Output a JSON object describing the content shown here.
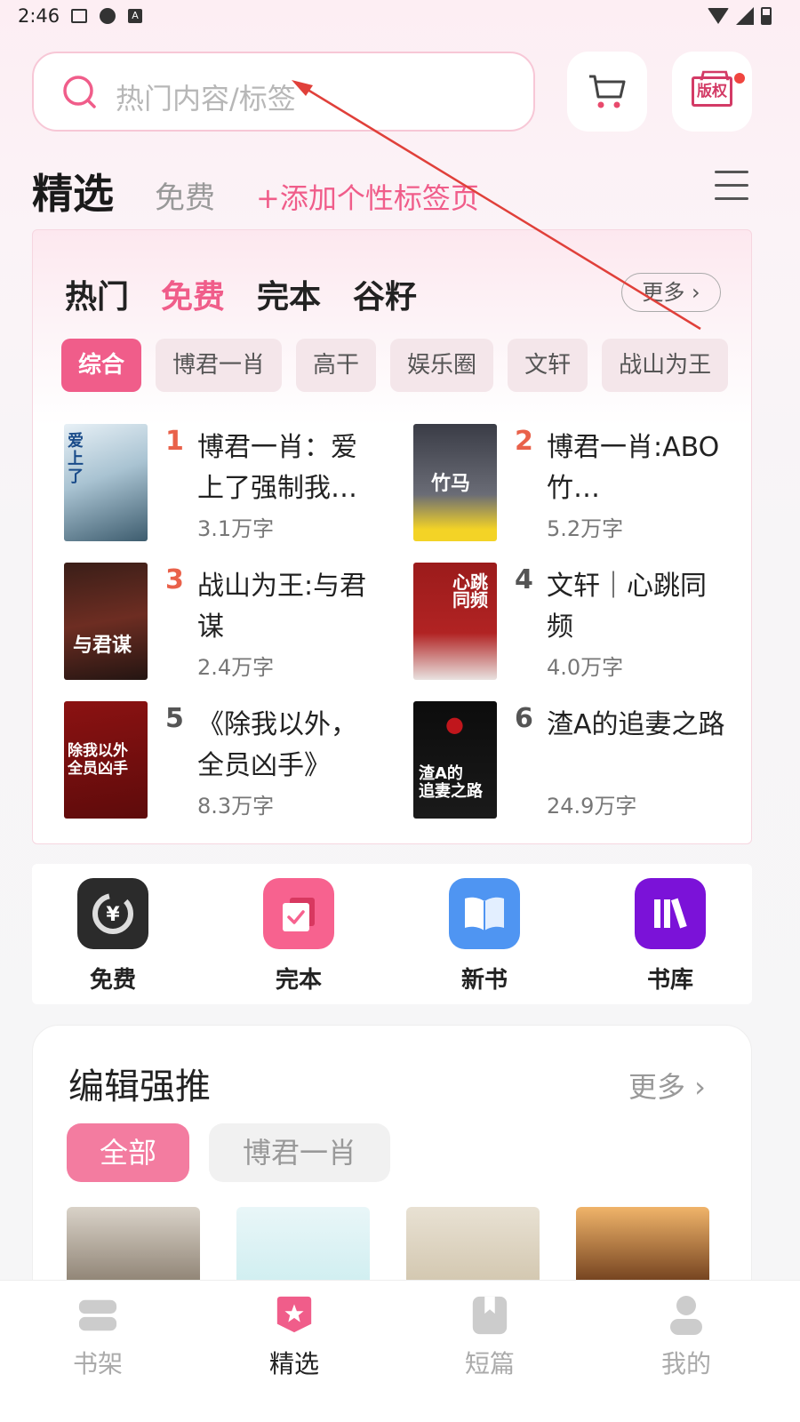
{
  "status_bar": {
    "time": "2:46",
    "a_icon": "A"
  },
  "header": {
    "search_placeholder": "热门内容/标签",
    "copyright_label": "版权"
  },
  "top_tabs": {
    "selected": "精选",
    "free": "免费",
    "add_tag": "+添加个性标签页"
  },
  "ranking": {
    "tabs": [
      "热门",
      "免费",
      "完本",
      "谷籽"
    ],
    "active_tab": "免费",
    "more_label": "更多 ›",
    "chips": [
      "综合",
      "博君一肖",
      "高干",
      "娱乐圈",
      "文轩",
      "战山为王"
    ],
    "books": [
      {
        "rank": "1",
        "title": "博君一肖：爱上了强制我…",
        "words": "3.1万字"
      },
      {
        "rank": "2",
        "title": "博君一肖:ABO竹…",
        "words": "5.2万字"
      },
      {
        "rank": "3",
        "title": "战山为王:与君谋",
        "words": "2.4万字"
      },
      {
        "rank": "4",
        "title": "文轩｜心跳同频",
        "words": "4.0万字"
      },
      {
        "rank": "5",
        "title": "《除我以外，全员凶手》",
        "words": "8.3万字"
      },
      {
        "rank": "6",
        "title": "渣A的追妻之路",
        "words": "24.9万字"
      }
    ]
  },
  "quick_entries": [
    {
      "label": "免费",
      "icon": "free-coin-icon",
      "color": "#2b2b2b"
    },
    {
      "label": "完本",
      "icon": "finished-check-icon",
      "color": "#f7628f"
    },
    {
      "label": "新书",
      "icon": "open-book-icon",
      "color": "#4f95f2"
    },
    {
      "label": "书库",
      "icon": "library-icon",
      "color": "#7b12d8"
    }
  ],
  "editor_picks": {
    "title": "编辑强推",
    "more_label": "更多 ›",
    "chips": [
      "全部",
      "博君一肖"
    ]
  },
  "bottom_nav": [
    {
      "label": "书架",
      "icon": "bookshelf-icon"
    },
    {
      "label": "精选",
      "icon": "star-tag-icon"
    },
    {
      "label": "短篇",
      "icon": "short-book-icon"
    },
    {
      "label": "我的",
      "icon": "profile-icon"
    }
  ],
  "colors": {
    "accent": "#f05d8a",
    "rank_top": "#e9614a",
    "arrow": "#e0403a"
  }
}
